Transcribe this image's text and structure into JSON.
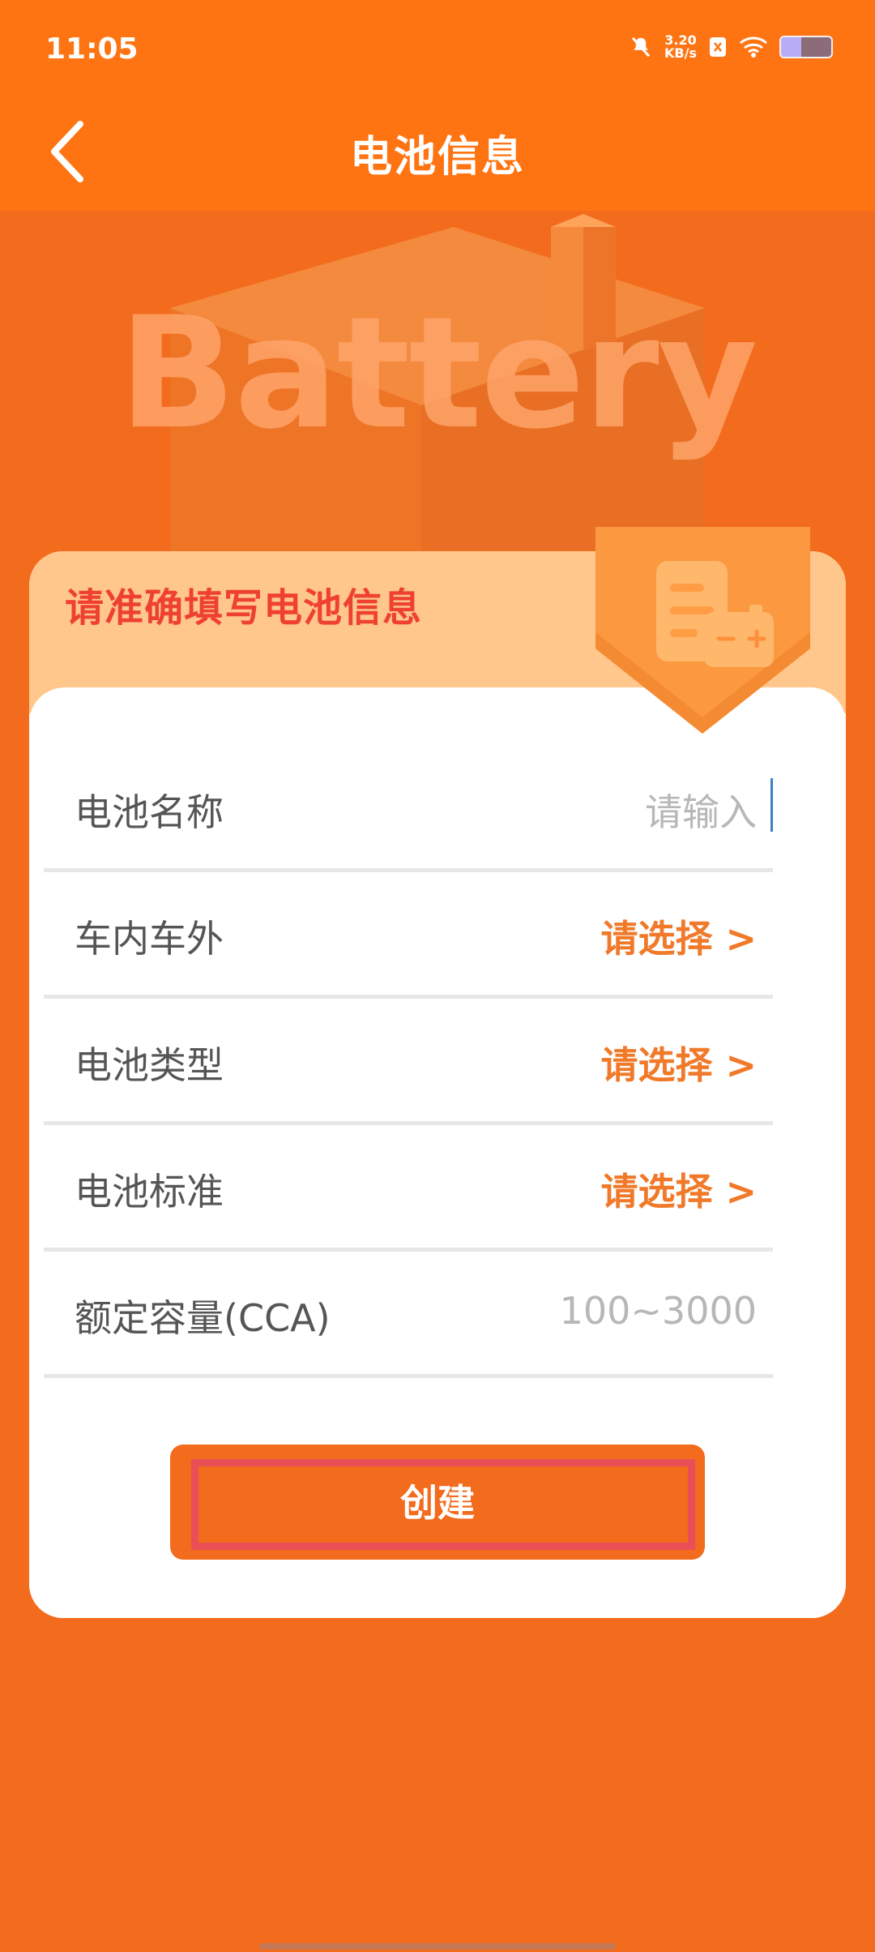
{
  "status_bar": {
    "time": "11:05",
    "network_speed_value": "3.20",
    "network_speed_unit": "KB/s",
    "battery_level": 0.4
  },
  "app_bar": {
    "title": "电池信息"
  },
  "hero": {
    "word": "Battery"
  },
  "card": {
    "header_title": "请准确填写电池信息",
    "fields": [
      {
        "label": "电池名称",
        "value": "请输入"
      },
      {
        "label": "车内车外",
        "value": "请选择 >"
      },
      {
        "label": "电池类型",
        "value": "请选择 >"
      },
      {
        "label": "电池标准",
        "value": "请选择 >"
      },
      {
        "label": "额定容量(CCA)",
        "value": "100~3000"
      }
    ]
  },
  "actions": {
    "create_label": "创建"
  },
  "colors": {
    "accent": "#f36b1c",
    "header": "#ff7412",
    "card_header": "#ffc78b",
    "title_red": "#ef4132",
    "select_orange": "#f07a2a"
  }
}
